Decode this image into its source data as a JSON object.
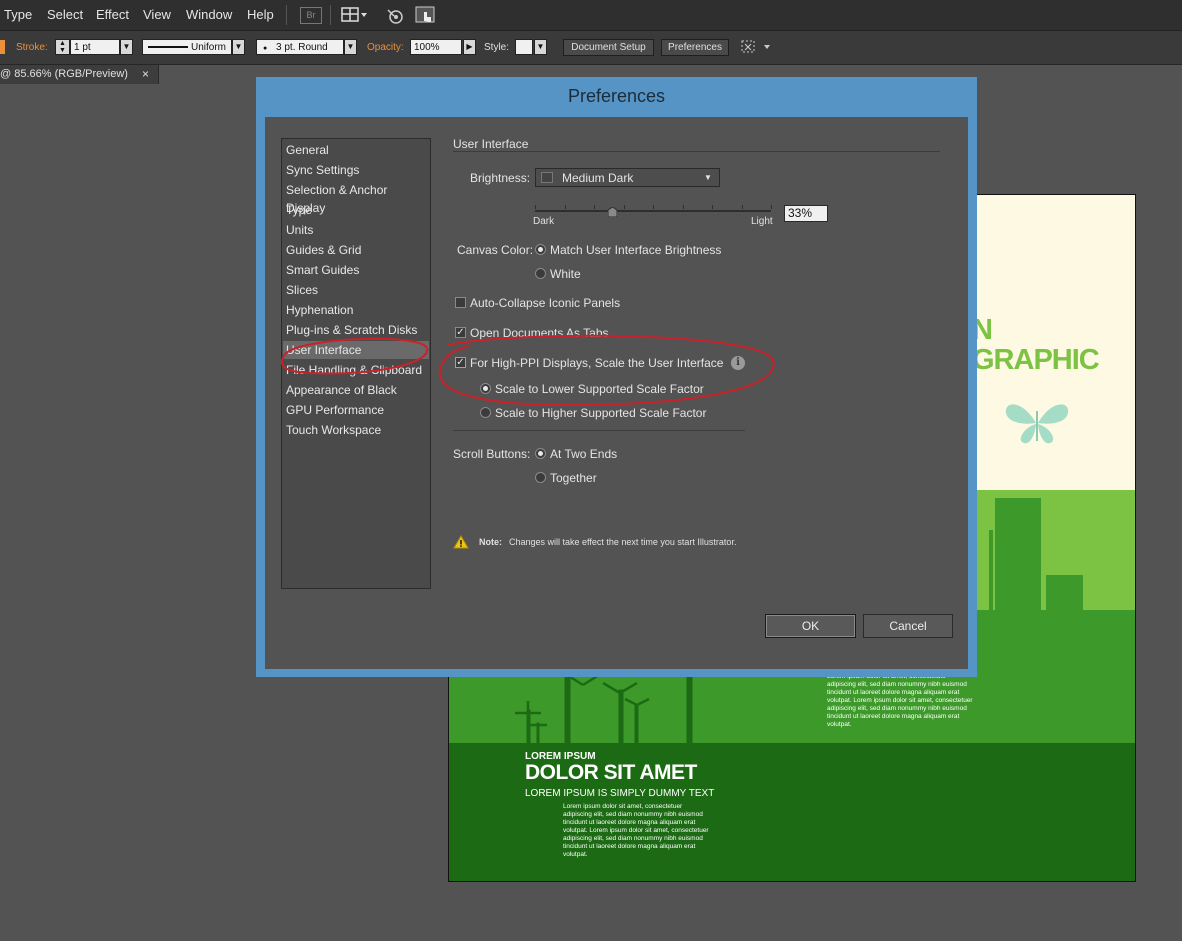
{
  "menubar": {
    "items": [
      "Type",
      "Select",
      "Effect",
      "View",
      "Window",
      "Help"
    ],
    "bridge_label": "Br"
  },
  "controlbar": {
    "stroke_label": "Stroke:",
    "stroke_value": "1 pt",
    "profile_label": "Uniform",
    "brush_label": "3 pt. Round",
    "opacity_label": "Opacity:",
    "opacity_value": "100%",
    "style_label": "Style:",
    "doc_setup_button": "Document Setup",
    "preferences_button": "Preferences"
  },
  "doc_tab": {
    "title": "@ 85.66% (RGB/Preview)",
    "close": "×"
  },
  "artwork": {
    "title_fragment_1": "N",
    "title_fragment_2": "GRAPHIC",
    "body_right": "Lorem ipsum dolor sit amet, consectetuer adipiscing elit, sed diam nonummy nibh euismod tincidunt ut laoreet dolore magna aliquam erat volutpat. Lorem ipsum dolor sit amet, consectetuer adipiscing elit, sed diam nonummy nibh euismod tincidunt ut laoreet dolore magna aliquam erat volutpat.",
    "heading_small": "LOREM IPSUM",
    "heading_large": "DOLOR SIT AMET",
    "subheading": "LOREM IPSUM IS SIMPLY DUMMY TEXT",
    "body_left": "Lorem ipsum dolor sit amet, consectetuer adipiscing elit, sed diam nonummy nibh euismod tincidunt ut laoreet dolore magna aliquam erat volutpat. Lorem ipsum dolor sit amet, consectetuer adipiscing elit, sed diam nonummy nibh euismod tincidunt ut laoreet dolore magna aliquam erat volutpat."
  },
  "dialog": {
    "title": "Preferences",
    "sidebar": [
      "General",
      "Sync Settings",
      "Selection & Anchor Display",
      "Type",
      "Units",
      "Guides & Grid",
      "Smart Guides",
      "Slices",
      "Hyphenation",
      "Plug-ins & Scratch Disks",
      "User Interface",
      "File Handling & Clipboard",
      "Appearance of Black",
      "GPU Performance",
      "Touch Workspace"
    ],
    "active_item": "User Interface",
    "section_title": "User Interface",
    "brightness_label": "Brightness:",
    "brightness_value": "Medium Dark",
    "slider_dark": "Dark",
    "slider_light": "Light",
    "slider_value": "33%",
    "slider_fraction": 0.33,
    "canvas_color_label": "Canvas Color:",
    "canvas_opt1": "Match User Interface Brightness",
    "canvas_opt2": "White",
    "auto_collapse": "Auto-Collapse Iconic Panels",
    "open_docs_tabs": "Open Documents As Tabs",
    "high_ppi": "For High-PPI Displays, Scale the User Interface",
    "scale_lower": "Scale to Lower Supported Scale Factor",
    "scale_higher": "Scale to Higher Supported Scale Factor",
    "scroll_label": "Scroll Buttons:",
    "scroll_opt1": "At Two Ends",
    "scroll_opt2": "Together",
    "note_label": "Note:",
    "note_text": "Changes will take effect the next time you start Illustrator.",
    "ok_button": "OK",
    "cancel_button": "Cancel"
  },
  "colors": {
    "dialog_frame": "#5694c6",
    "annotation": "#c8222a",
    "art_light_green": "#7cc243",
    "art_mid_green": "#3d9a2a",
    "art_dark_green": "#1c6b14"
  }
}
